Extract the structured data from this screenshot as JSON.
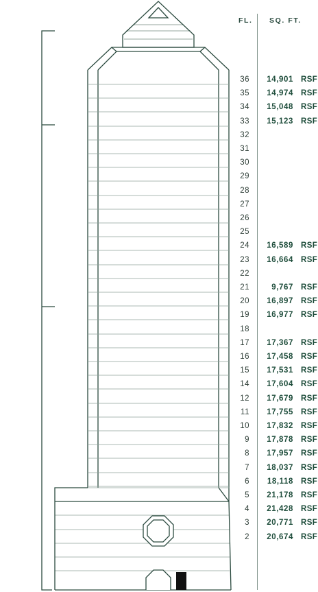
{
  "header": {
    "floor_label": "FL.",
    "sqft_label": "SQ. FT."
  },
  "colors": {
    "line": "#2b4a3f",
    "text": "#1e4d3b",
    "divider": "#7f938a"
  },
  "floors": [
    {
      "fl": "36",
      "sqft": "14,901",
      "unit": "RSF"
    },
    {
      "fl": "35",
      "sqft": "14,974",
      "unit": "RSF"
    },
    {
      "fl": "34",
      "sqft": "15,048",
      "unit": "RSF"
    },
    {
      "fl": "33",
      "sqft": "15,123",
      "unit": "RSF"
    },
    {
      "fl": "32",
      "sqft": "",
      "unit": ""
    },
    {
      "fl": "31",
      "sqft": "",
      "unit": ""
    },
    {
      "fl": "30",
      "sqft": "",
      "unit": ""
    },
    {
      "fl": "29",
      "sqft": "",
      "unit": ""
    },
    {
      "fl": "28",
      "sqft": "",
      "unit": ""
    },
    {
      "fl": "27",
      "sqft": "",
      "unit": ""
    },
    {
      "fl": "26",
      "sqft": "",
      "unit": ""
    },
    {
      "fl": "25",
      "sqft": "",
      "unit": ""
    },
    {
      "fl": "24",
      "sqft": "16,589",
      "unit": "RSF"
    },
    {
      "fl": "23",
      "sqft": "16,664",
      "unit": "RSF"
    },
    {
      "fl": "22",
      "sqft": "",
      "unit": ""
    },
    {
      "fl": "21",
      "sqft": "9,767",
      "unit": "RSF"
    },
    {
      "fl": "20",
      "sqft": "16,897",
      "unit": "RSF"
    },
    {
      "fl": "19",
      "sqft": "16,977",
      "unit": "RSF"
    },
    {
      "fl": "18",
      "sqft": "",
      "unit": ""
    },
    {
      "fl": "17",
      "sqft": "17,367",
      "unit": "RSF"
    },
    {
      "fl": "16",
      "sqft": "17,458",
      "unit": "RSF"
    },
    {
      "fl": "15",
      "sqft": "17,531",
      "unit": "RSF"
    },
    {
      "fl": "14",
      "sqft": "17,604",
      "unit": "RSF"
    },
    {
      "fl": "12",
      "sqft": "17,679",
      "unit": "RSF"
    },
    {
      "fl": "11",
      "sqft": "17,755",
      "unit": "RSF"
    },
    {
      "fl": "10",
      "sqft": "17,832",
      "unit": "RSF"
    },
    {
      "fl": "9",
      "sqft": "17,878",
      "unit": "RSF"
    },
    {
      "fl": "8",
      "sqft": "17,957",
      "unit": "RSF"
    },
    {
      "fl": "7",
      "sqft": "18,037",
      "unit": "RSF"
    },
    {
      "fl": "6",
      "sqft": "18,118",
      "unit": "RSF"
    },
    {
      "fl": "5",
      "sqft": "21,178",
      "unit": "RSF"
    },
    {
      "fl": "4",
      "sqft": "21,428",
      "unit": "RSF"
    },
    {
      "fl": "3",
      "sqft": "20,771",
      "unit": "RSF"
    },
    {
      "fl": "2",
      "sqft": "20,674",
      "unit": "RSF"
    }
  ]
}
